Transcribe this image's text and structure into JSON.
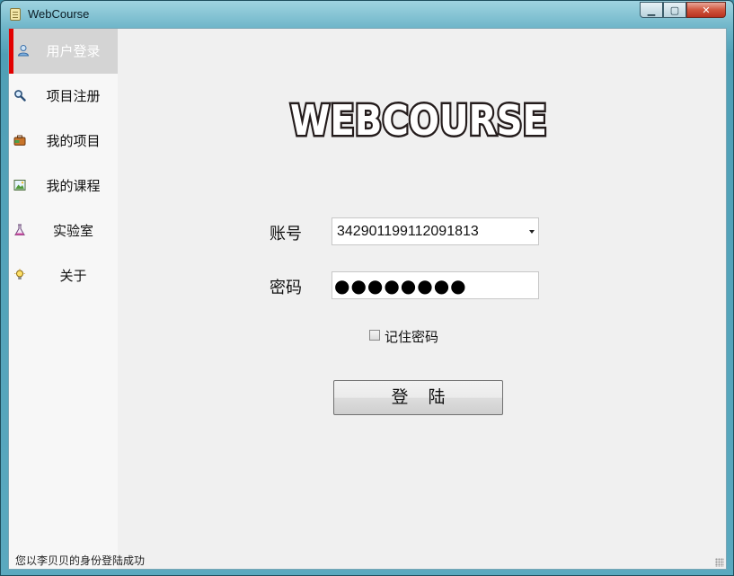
{
  "window": {
    "title": "WebCourse",
    "controls": {
      "minimize": "▁",
      "maximize": "▢",
      "close": "✕"
    }
  },
  "sidebar": {
    "items": [
      {
        "label": "用户登录",
        "icon": "user-icon",
        "active": true
      },
      {
        "label": "项目注册",
        "icon": "search-icon",
        "active": false
      },
      {
        "label": "我的项目",
        "icon": "briefcase-icon",
        "active": false
      },
      {
        "label": "我的课程",
        "icon": "picture-icon",
        "active": false
      },
      {
        "label": "实验室",
        "icon": "flask-icon",
        "active": false
      },
      {
        "label": "关于",
        "icon": "lightbulb-icon",
        "active": false
      }
    ]
  },
  "login": {
    "logo_text": "WEBCOURSE",
    "account_label": "账号",
    "account_value": "342901199112091813",
    "password_label": "密码",
    "password_masked": "●●●●●●●●",
    "remember_label": "记住密码",
    "remember_checked": false,
    "submit_label": "登陆"
  },
  "statusbar": {
    "message": "您以李贝贝的身份登陆成功"
  },
  "colors": {
    "active_accent": "#e20000",
    "active_bg": "#d4d4d4",
    "content_bg": "#f0f0f0"
  }
}
